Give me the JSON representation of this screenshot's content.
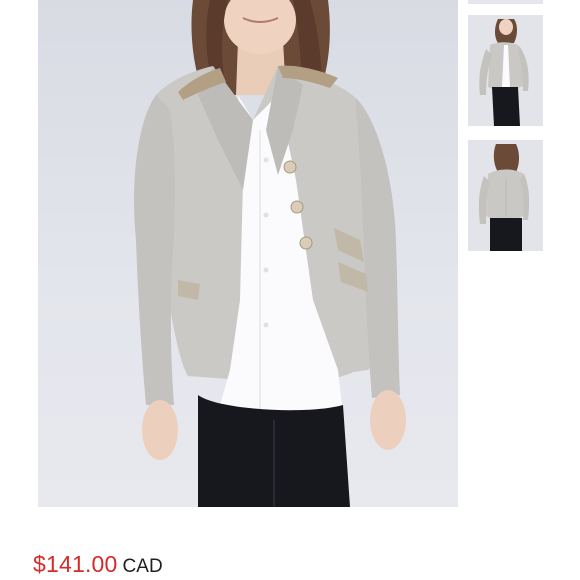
{
  "listing": {
    "price": {
      "amount": "$141.00",
      "currency": "CAD"
    },
    "images": {
      "main": {
        "subject": "model-wearing-grey-tweed-blazer-front"
      },
      "thumbnails": [
        {
          "subject": "partial-thumbnail"
        },
        {
          "subject": "model-blazer-side-view"
        },
        {
          "subject": "model-blazer-back-view"
        }
      ]
    }
  },
  "colors": {
    "price": "#d72a2a",
    "currency": "#1f1f1f",
    "photo_background": "#dfe1e9",
    "blazer": "#c9c8c4",
    "shirt": "#ffffff",
    "pants": "#17181e",
    "hair": "#6b4a38",
    "collar_accent": "#b3a084"
  }
}
